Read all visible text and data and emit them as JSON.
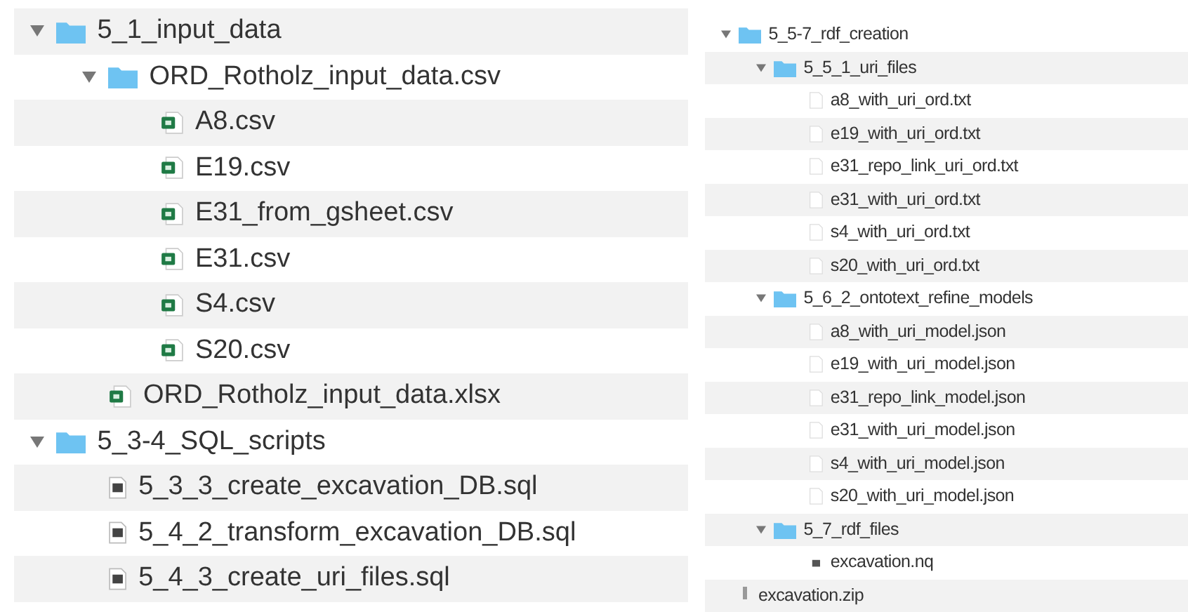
{
  "panels": [
    {
      "items": [
        {
          "name": "5_1_input_data",
          "kind": "folder",
          "expanded": true,
          "children": [
            {
              "name": "ORD_Rotholz_input_data.csv",
              "kind": "folder",
              "expanded": true,
              "children": [
                {
                  "name": "A8.csv",
                  "kind": "csv"
                },
                {
                  "name": "E19.csv",
                  "kind": "csv"
                },
                {
                  "name": "E31_from_gsheet.csv",
                  "kind": "csv"
                },
                {
                  "name": "E31.csv",
                  "kind": "csv"
                },
                {
                  "name": "S4.csv",
                  "kind": "csv"
                },
                {
                  "name": "S20.csv",
                  "kind": "csv"
                }
              ]
            },
            {
              "name": "ORD_Rotholz_input_data.xlsx",
              "kind": "xlsx"
            }
          ]
        },
        {
          "name": "5_3-4_SQL_scripts",
          "kind": "folder",
          "expanded": true,
          "children": [
            {
              "name": "5_3_3_create_excavation_DB.sql",
              "kind": "sql"
            },
            {
              "name": "5_4_2_transform_excavation_DB.sql",
              "kind": "sql"
            },
            {
              "name": "5_4_3_create_uri_files.sql",
              "kind": "sql"
            }
          ]
        }
      ]
    },
    {
      "items": [
        {
          "name": "5_5-7_rdf_creation",
          "kind": "folder",
          "expanded": true,
          "children": [
            {
              "name": "5_5_1_uri_files",
              "kind": "folder",
              "expanded": true,
              "children": [
                {
                  "name": "a8_with_uri_ord.txt",
                  "kind": "text"
                },
                {
                  "name": "e19_with_uri_ord.txt",
                  "kind": "text"
                },
                {
                  "name": "e31_repo_link_uri_ord.txt",
                  "kind": "text"
                },
                {
                  "name": "e31_with_uri_ord.txt",
                  "kind": "text"
                },
                {
                  "name": "s4_with_uri_ord.txt",
                  "kind": "text"
                },
                {
                  "name": "s20_with_uri_ord.txt",
                  "kind": "text"
                }
              ]
            },
            {
              "name": "5_6_2_ontotext_refine_models",
              "kind": "folder",
              "expanded": true,
              "children": [
                {
                  "name": "a8_with_uri_model.json",
                  "kind": "text"
                },
                {
                  "name": "e19_with_uri_model.json",
                  "kind": "text"
                },
                {
                  "name": "e31_repo_link_model.json",
                  "kind": "text"
                },
                {
                  "name": "e31_with_uri_model.json",
                  "kind": "text"
                },
                {
                  "name": "s4_with_uri_model.json",
                  "kind": "text"
                },
                {
                  "name": "s20_with_uri_model.json",
                  "kind": "text"
                }
              ]
            },
            {
              "name": "5_7_rdf_files",
              "kind": "folder",
              "expanded": true,
              "children": [
                {
                  "name": "excavation.nq",
                  "kind": "nq"
                }
              ]
            }
          ]
        },
        {
          "name": "excavation.zip",
          "kind": "zip"
        }
      ]
    }
  ]
}
